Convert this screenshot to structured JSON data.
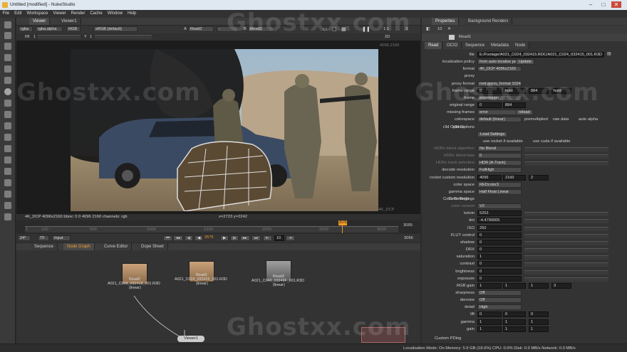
{
  "window": {
    "title": "Untitled [modified] - NukeStudio",
    "controls": [
      "–",
      "□",
      "✕"
    ]
  },
  "menu": [
    "File",
    "Edit",
    "Workspace",
    "Viewer",
    "Render",
    "Cache",
    "Window",
    "Help"
  ],
  "viewer": {
    "tabs": [
      "Viewer",
      "Viewer1"
    ],
    "channels": "rgba",
    "layer": "rgba.alpha",
    "colorspace": "RGB",
    "lut": "sRGB (default)",
    "input_a": "Read2",
    "input_b": "Read1",
    "a_label": "A",
    "b_label": "B",
    "dash": "-",
    "gain_label": "f/8",
    "gain_value": "1",
    "gamma_label": "Y",
    "gamma_value": "1",
    "mode": "2D",
    "zoom": "1:1",
    "proxy": "3",
    "format_tr": "4096,2160",
    "format_br": "4K_DCP",
    "info_left": "4K_DCP 4096x2160  bbox: 0 0 4096 2160 channels: rgb",
    "info_mid": "x=2723 y=2242",
    "timeline_marks": [
      "1",
      "100",
      "500",
      "1000",
      "1500",
      "2000",
      "2500",
      "3000",
      "3055"
    ],
    "timeline_end": "3055",
    "playhead_top": "2575",
    "fps": "24*",
    "tf": "TF",
    "input": "Input",
    "frame": "2575",
    "inc": "10",
    "last": "3056"
  },
  "bottom_tabs": [
    "Sequence",
    "Node Graph",
    "Curve Editor",
    "Dope Sheet"
  ],
  "nodes": [
    {
      "name": "Read2",
      "file": "A021_C009_032418_001.R3D",
      "sub": "(linear)"
    },
    {
      "name": "Read1",
      "file": "A021_C024_032415_001.R3D",
      "sub": "(linear)"
    },
    {
      "name": "Read3",
      "file": "A021_C040_03249F_001.R3D",
      "sub": "(linear)"
    },
    {
      "name": "Viewer1"
    }
  ],
  "properties": {
    "tabs": [
      "Properties",
      "Background Renders"
    ],
    "node": "Read1",
    "subtabs": [
      "Read",
      "OCIO",
      "Sequence",
      "Metadata",
      "Node"
    ],
    "rows": [
      {
        "label": "file",
        "value": "E:/Footage/A021_C024_032415.RDC/A021_C024_032415_001.R3D"
      },
      {
        "label": "localization policy",
        "value": "from auto-localize path",
        "extra": "Update"
      },
      {
        "label": "format",
        "value": "4K_DCP 4096x2160"
      },
      {
        "label": "proxy",
        "value": ""
      },
      {
        "label": "proxy format",
        "value": "root.proxy_format 1024x778"
      },
      {
        "label": "frame range",
        "value": "0",
        "v2": "hold",
        "v3": "884",
        "v4": "hold"
      },
      {
        "label": "frame",
        "value": "expression"
      },
      {
        "label": "original range",
        "value": "0",
        "v2": "884"
      },
      {
        "label": "missing frames",
        "value": "error",
        "extra": "reload"
      },
      {
        "label": "colorspace",
        "value": "default (linear)",
        "c1": "premultiplied",
        "c2": "raw data",
        "c3": "auto alpha"
      },
      {
        "label": "r3d Options",
        "value": ""
      },
      {
        "label": "",
        "value": "",
        "extra": "Load Settings"
      },
      {
        "label": "",
        "value": "",
        "c1": "use rocket if available",
        "c2": "use cuda if available"
      },
      {
        "label": "HDRx blend algorithm",
        "value": "No Blend"
      },
      {
        "label": "HDRx blend bias",
        "value": "0"
      },
      {
        "label": "HDRx track selection",
        "value": "HDR (A-Track)"
      },
      {
        "label": "decode resolution",
        "value": "FullHigh"
      },
      {
        "label": "rocket custom resolution",
        "value": "4096",
        "v2": "2160",
        "v3": "2"
      },
      {
        "label": "color space",
        "value": "REDcolor3"
      },
      {
        "label": "gamma space",
        "value": "Half Float Linear"
      },
      {
        "label": "Color Settings",
        "value": ""
      },
      {
        "label": "color version",
        "value": "V2"
      },
      {
        "label": "kelvin",
        "value": "5253"
      },
      {
        "label": "tint",
        "value": "-4.4790005"
      },
      {
        "label": "ISO",
        "value": "250"
      },
      {
        "label": "FLUT control",
        "value": "0"
      },
      {
        "label": "shadow",
        "value": "0"
      },
      {
        "label": "DRX",
        "value": "0"
      },
      {
        "label": "saturation",
        "value": "1"
      },
      {
        "label": "contrast",
        "value": "0"
      },
      {
        "label": "brightness",
        "value": "0"
      },
      {
        "label": "exposure",
        "value": "0"
      },
      {
        "label": "RGB gain",
        "value": "1",
        "v2": "1",
        "v3": "1",
        "v4": "3"
      },
      {
        "label": "sharpness",
        "value": "Off"
      },
      {
        "label": "denoise",
        "value": "Off"
      },
      {
        "label": "detail",
        "value": "High"
      },
      {
        "label": "lift",
        "value": "0",
        "v2": "0",
        "v3": "0"
      },
      {
        "label": "gamma",
        "value": "1",
        "v2": "1",
        "v3": "1"
      },
      {
        "label": "gain",
        "value": "1",
        "v2": "1",
        "v3": "1"
      }
    ],
    "custom_pdlog": "Custom PDlog"
  },
  "status": "Localization Mode: On Memory: 5.9 GB (18.6%) CPU: 0.0% Disk: 0.0 MB/s Network: 0.0 MB/s",
  "watermark": "Ghostxx.com",
  "colors": {
    "accent": "#f39a2b",
    "panel": "#3a3a3a",
    "dark": "#1f1f1f"
  }
}
